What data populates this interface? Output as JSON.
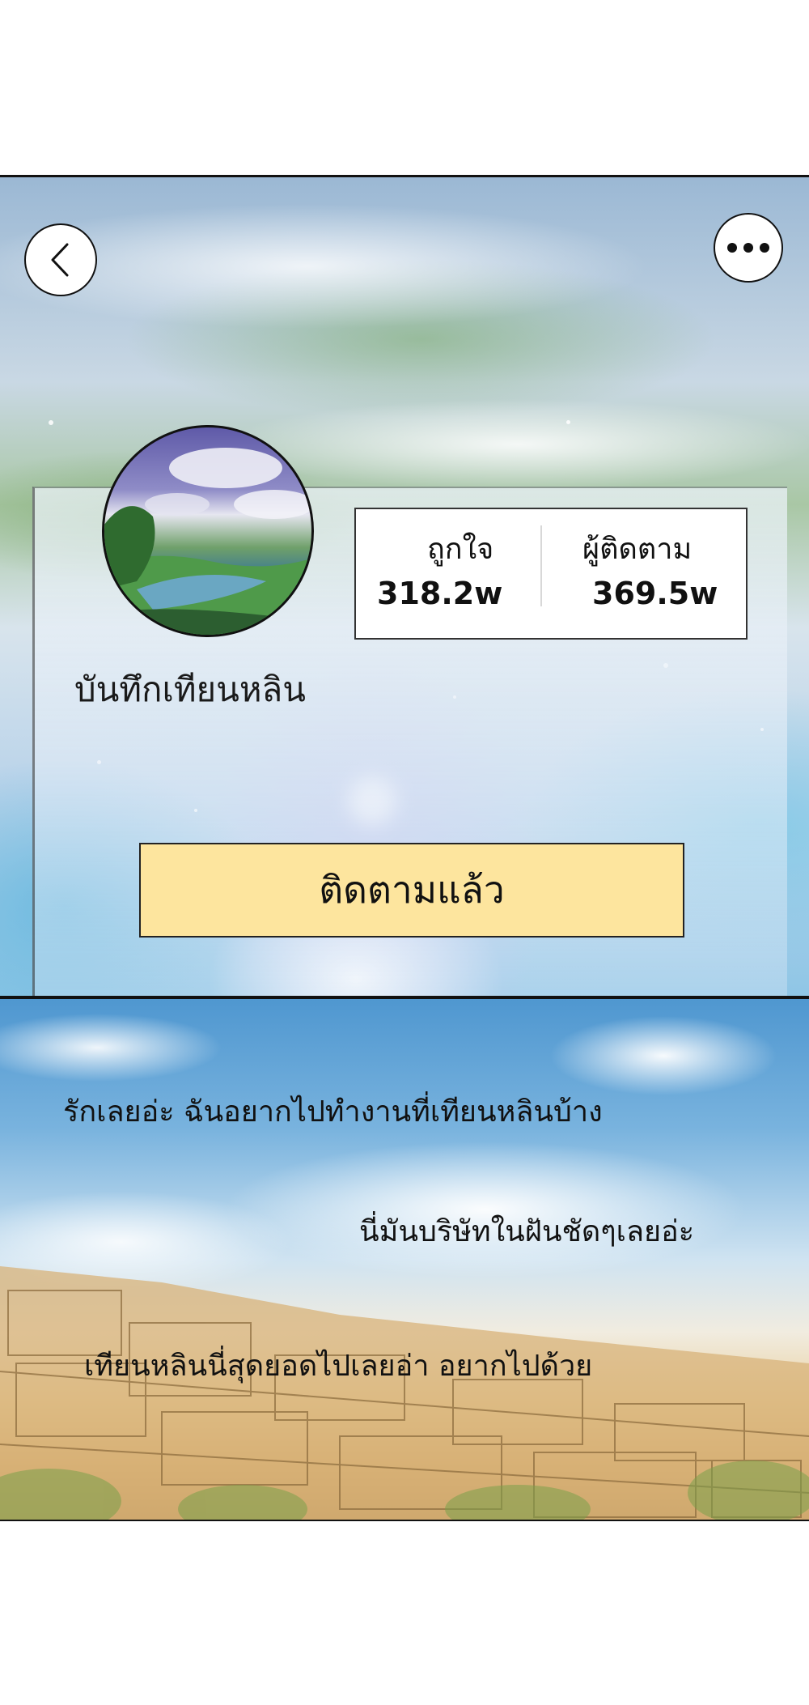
{
  "header": {
    "back_icon": "chevron-left-icon",
    "more_icon": "more-horizontal-icon"
  },
  "profile": {
    "username": "บันทึกเทียนหลิน",
    "stats": {
      "likes_label": "ถูกใจ",
      "likes_value": "318.2w",
      "followers_label": "ผู้ติดตาม",
      "followers_value": "369.5w"
    },
    "follow_button_label": "ติดตามแล้ว"
  },
  "comments": [
    {
      "text": "รักเลยอ่ะ ฉันอยากไปทำงานที่เทียนหลินบ้าง"
    },
    {
      "text": "นี่มันบริษัทในฝันชัดๆเลยอ่ะ"
    },
    {
      "text": "เทียนหลินนี่สุดยอดไปเลยอ่า อยากไปด้วย"
    }
  ],
  "colors": {
    "follow_button_bg": "#fde59e",
    "border": "#111111"
  }
}
